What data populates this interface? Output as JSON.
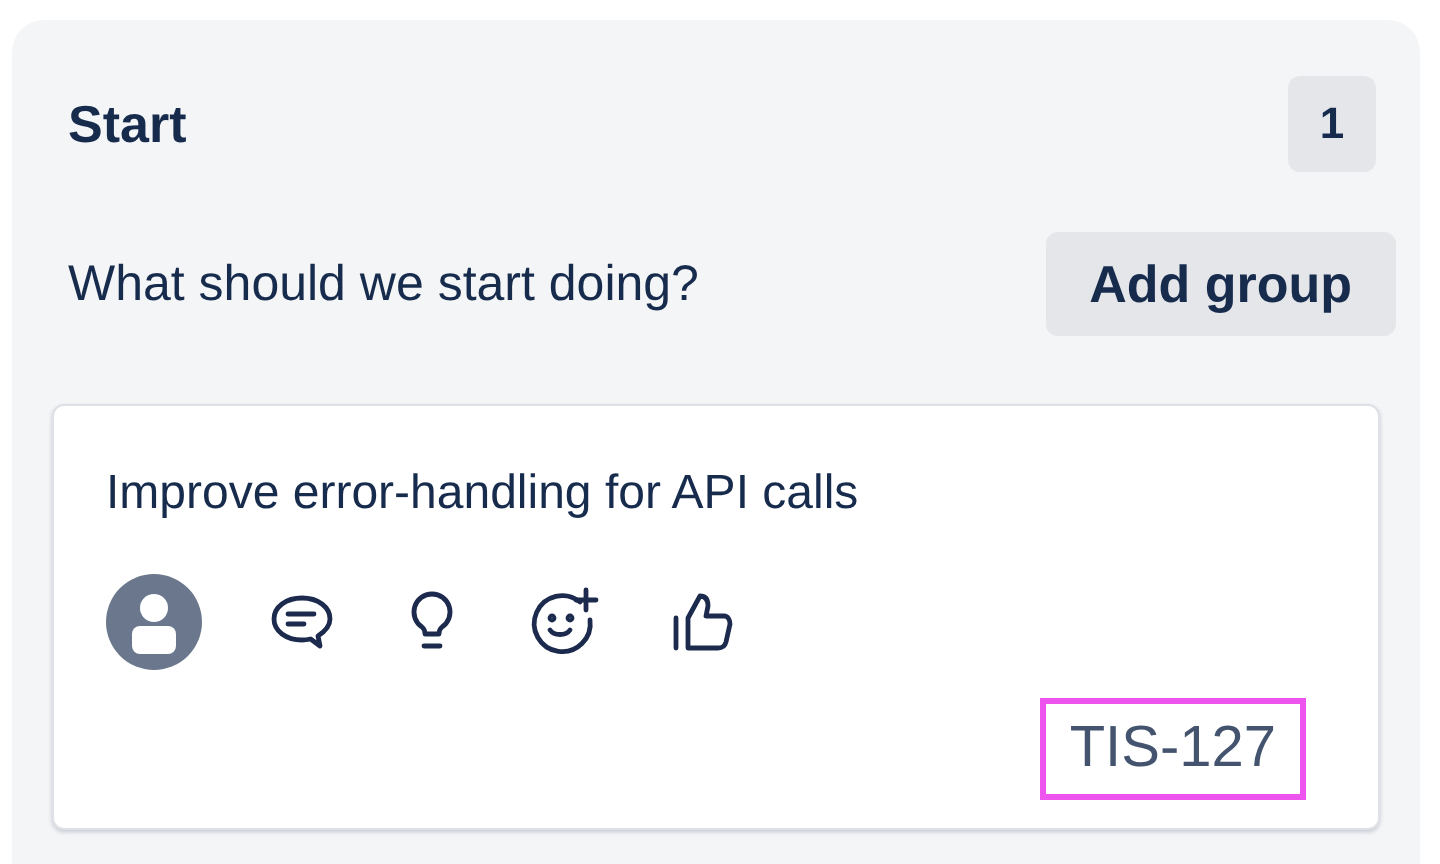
{
  "column": {
    "title": "Start",
    "count": "1",
    "prompt": "What should we start doing?",
    "add_button": "Add group"
  },
  "cards": [
    {
      "text": "Improve error-handling for API calls",
      "issue_key": "TIS-127",
      "issue_highlighted": true
    }
  ]
}
